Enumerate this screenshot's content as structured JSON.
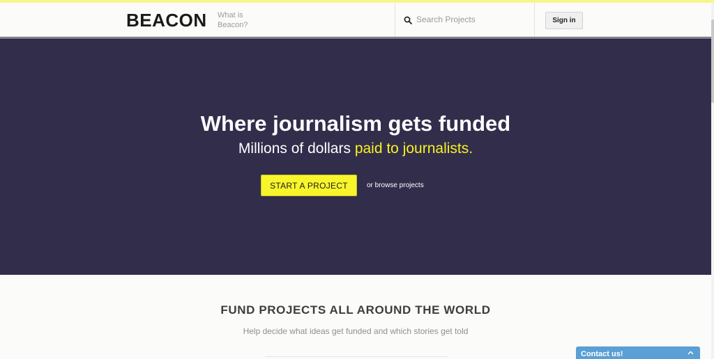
{
  "header": {
    "logo": "BEACON",
    "what_is": "What is Beacon?",
    "search": {
      "placeholder": "Search Projects",
      "icon": "search-icon"
    },
    "signin_label": "Sign in"
  },
  "hero": {
    "title": "Where journalism gets funded",
    "subtitle_plain": "Millions of dollars ",
    "subtitle_highlight": "paid to journalists.",
    "cta_label": "START A PROJECT",
    "browse_link": "or browse projects"
  },
  "section": {
    "title": "FUND PROJECTS ALL AROUND THE WORLD",
    "subtitle": "Help decide what ideas get funded and which stories get told"
  },
  "contact": {
    "label": "Contact us!",
    "icon": "chevron-up-icon"
  },
  "colors": {
    "hero_bg": "#322d4b",
    "accent_yellow": "#f8f52b",
    "contact_blue": "#5a9fd5"
  }
}
